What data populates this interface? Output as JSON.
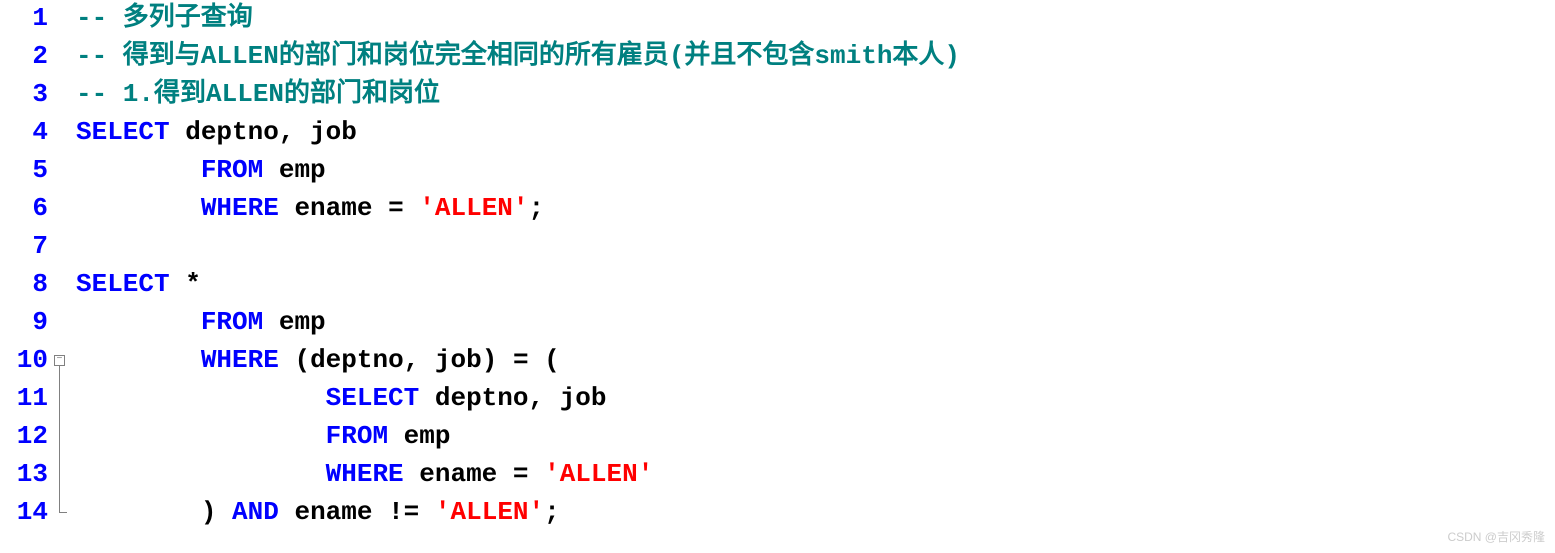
{
  "lines": [
    {
      "num": "1",
      "tokens": [
        [
          "comment",
          "-- 多列子查询"
        ]
      ]
    },
    {
      "num": "2",
      "tokens": [
        [
          "comment",
          "-- 得到与ALLEN的部门和岗位完全相同的所有雇员(并且不包含smith本人)"
        ]
      ]
    },
    {
      "num": "3",
      "tokens": [
        [
          "comment",
          "-- 1.得到ALLEN的部门和岗位"
        ]
      ]
    },
    {
      "num": "4",
      "tokens": [
        [
          "keyword",
          "SELECT"
        ],
        [
          "text",
          " deptno"
        ],
        [
          "punct",
          ","
        ],
        [
          "text",
          " job"
        ]
      ]
    },
    {
      "num": "5",
      "tokens": [
        [
          "text",
          "        "
        ],
        [
          "keyword",
          "FROM"
        ],
        [
          "text",
          " emp"
        ]
      ]
    },
    {
      "num": "6",
      "tokens": [
        [
          "text",
          "        "
        ],
        [
          "keyword",
          "WHERE"
        ],
        [
          "text",
          " ename "
        ],
        [
          "operator",
          "="
        ],
        [
          "text",
          " "
        ],
        [
          "string",
          "'ALLEN'"
        ],
        [
          "punct",
          ";"
        ]
      ]
    },
    {
      "num": "7",
      "tokens": [
        [
          "text",
          ""
        ]
      ]
    },
    {
      "num": "8",
      "tokens": [
        [
          "keyword",
          "SELECT"
        ],
        [
          "text",
          " "
        ],
        [
          "operator",
          "*"
        ]
      ]
    },
    {
      "num": "9",
      "tokens": [
        [
          "text",
          "        "
        ],
        [
          "keyword",
          "FROM"
        ],
        [
          "text",
          " emp"
        ]
      ]
    },
    {
      "num": "10",
      "tokens": [
        [
          "text",
          "        "
        ],
        [
          "keyword",
          "WHERE"
        ],
        [
          "text",
          " "
        ],
        [
          "punct",
          "("
        ],
        [
          "text",
          "deptno"
        ],
        [
          "punct",
          ","
        ],
        [
          "text",
          " job"
        ],
        [
          "punct",
          ")"
        ],
        [
          "text",
          " "
        ],
        [
          "operator",
          "="
        ],
        [
          "text",
          " "
        ],
        [
          "punct",
          "("
        ]
      ]
    },
    {
      "num": "11",
      "tokens": [
        [
          "text",
          "                "
        ],
        [
          "keyword",
          "SELECT"
        ],
        [
          "text",
          " deptno"
        ],
        [
          "punct",
          ","
        ],
        [
          "text",
          " job"
        ]
      ]
    },
    {
      "num": "12",
      "tokens": [
        [
          "text",
          "                "
        ],
        [
          "keyword",
          "FROM"
        ],
        [
          "text",
          " emp"
        ]
      ]
    },
    {
      "num": "13",
      "tokens": [
        [
          "text",
          "                "
        ],
        [
          "keyword",
          "WHERE"
        ],
        [
          "text",
          " ename "
        ],
        [
          "operator",
          "="
        ],
        [
          "text",
          " "
        ],
        [
          "string",
          "'ALLEN'"
        ]
      ]
    },
    {
      "num": "14",
      "tokens": [
        [
          "text",
          "        "
        ],
        [
          "punct",
          ")"
        ],
        [
          "text",
          " "
        ],
        [
          "keyword",
          "AND"
        ],
        [
          "text",
          " ename "
        ],
        [
          "operator",
          "!="
        ],
        [
          "text",
          " "
        ],
        [
          "string",
          "'ALLEN'"
        ],
        [
          "punct",
          ";"
        ]
      ]
    }
  ],
  "fold": {
    "start_line_index": 9,
    "end_line_index": 13,
    "symbol": "−"
  },
  "watermark": "CSDN @吉冈秀隆"
}
